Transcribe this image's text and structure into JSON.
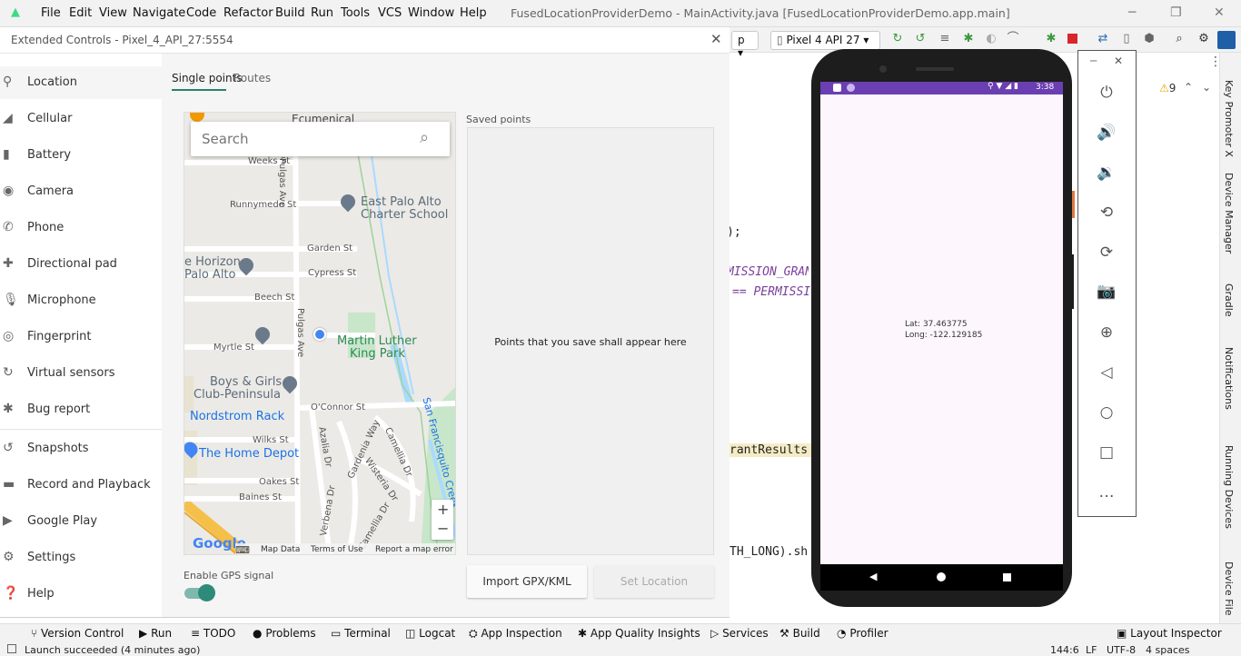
{
  "titlebar": {
    "menus": [
      "File",
      "Edit",
      "View",
      "Navigate",
      "Code",
      "Refactor",
      "Build",
      "Run",
      "Tools",
      "VCS",
      "Window",
      "Help"
    ],
    "title": "FusedLocationProviderDemo - MainActivity.java [FusedLocationProviderDemo.app.main]"
  },
  "ide": {
    "run_config": "p",
    "device": "Pixel 4 API 27",
    "warnings": "9",
    "code": [
      ")",
      " );",
      "MISSION_GRAN",
      "== PERMISSI",
      "rantResults",
      "TH_LONG).sh"
    ],
    "side_tools": [
      "Key Promoter X",
      "Device Manager",
      "Gradle",
      "Notifications",
      "Running Devices",
      "Device File"
    ]
  },
  "extended": {
    "title": "Extended Controls - Pixel_4_API_27:5554",
    "sidebar": [
      "Location",
      "Cellular",
      "Battery",
      "Camera",
      "Phone",
      "Directional pad",
      "Microphone",
      "Fingerprint",
      "Virtual sensors",
      "Bug report",
      "Snapshots",
      "Record and Playback",
      "Google Play",
      "Settings",
      "Help"
    ],
    "tabs": [
      "Single points",
      "Routes"
    ],
    "search_placeholder": "Search",
    "saved_points_label": "Saved points",
    "saved_empty": "Points that you save shall appear here",
    "gps_label": "Enable GPS signal",
    "import_button": "Import GPX/KML",
    "set_location_button": "Set Location",
    "map": {
      "streets": [
        "Ecumenical",
        "Weeks St",
        "Runnymede St",
        "Garden St",
        "Cypress St",
        "Beech St",
        "Myrtle St",
        "O'Connor St",
        "Wilks St",
        "Oakes St",
        "Baines St",
        "Pulgas Ave",
        "Pulgas Ave",
        "Azalia Dr",
        "Camellia Dr",
        "Wisteria Dr",
        "Gardenia Way",
        "Verbena Dr",
        "Camellia Dr"
      ],
      "places": [
        "East Palo Alto",
        "Charter School",
        "e Horizon",
        "Palo Alto",
        "Martin Luther",
        "King Park",
        "Boys & Girls",
        "Club-Peninsula",
        "Nordstrom Rack",
        "The Home Depot",
        "San Francisquito Creek"
      ],
      "footer": [
        "Google",
        "Map Data",
        "Terms of Use",
        "Report a map error"
      ],
      "zoom_in": "+",
      "zoom_out": "−"
    }
  },
  "phone": {
    "time": "3:38",
    "lat": "Lat: 37.463775",
    "long": "Long: -122.129185"
  },
  "bottom": {
    "tabs": [
      "Version Control",
      "Run",
      "TODO",
      "Problems",
      "Terminal",
      "Logcat",
      "App Inspection",
      "App Quality Insights",
      "Services",
      "Build",
      "Profiler",
      "Layout Inspector"
    ],
    "status": "Launch succeeded (4 minutes ago)",
    "position": "144:6",
    "line_sep": "LF",
    "encoding": "UTF-8",
    "indent": "4 spaces"
  },
  "colors": {
    "accent": "#2e7d6f",
    "map_water": "#aadaff",
    "park": "#c8e6c9",
    "pin": "#4285f4"
  }
}
